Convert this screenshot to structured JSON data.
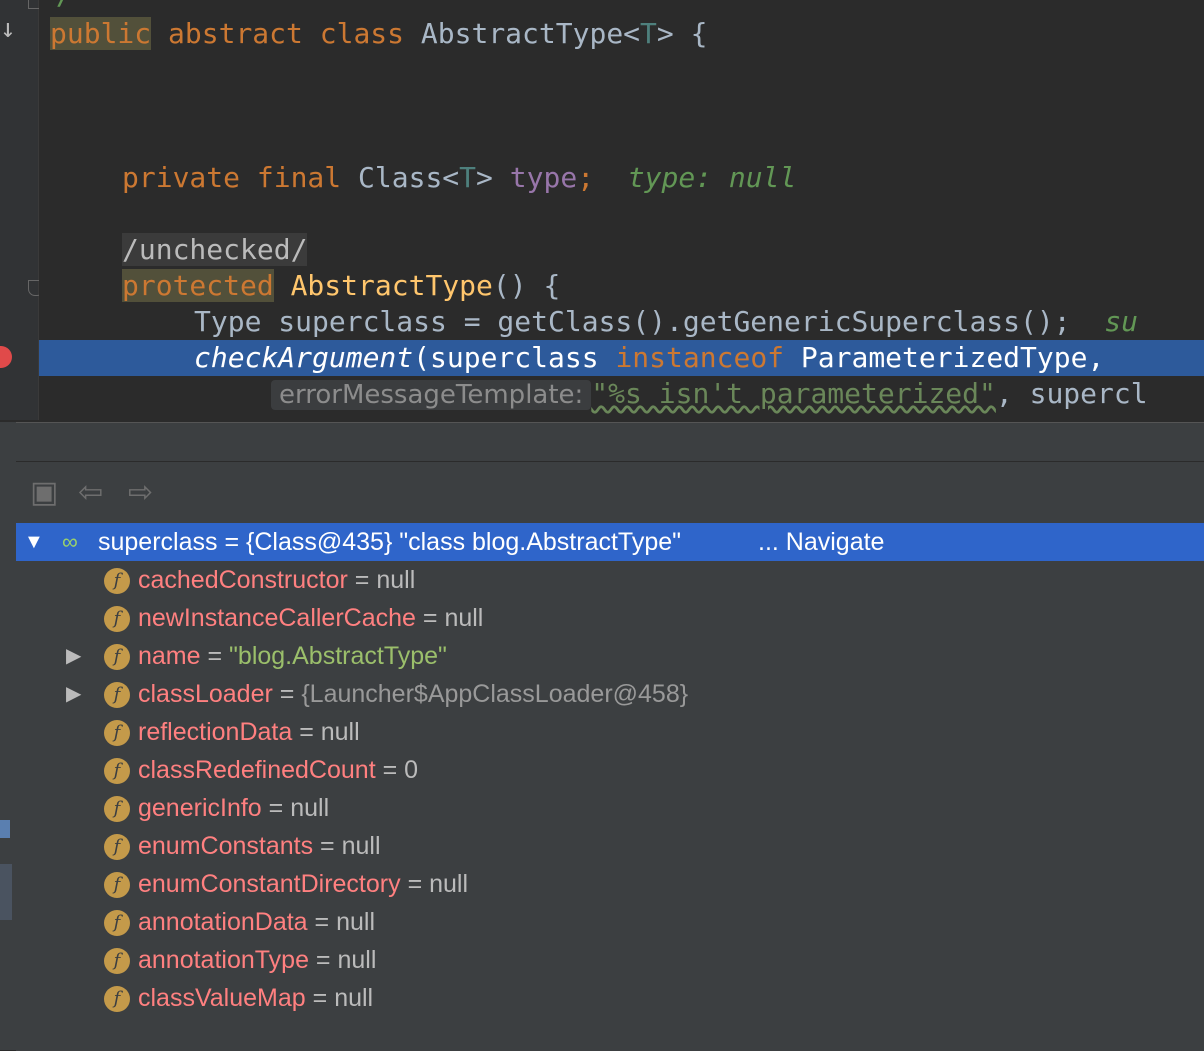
{
  "editor": {
    "line1": {
      "kw1": "public",
      "kw2": "abstract class",
      "name": "AbstractType<",
      "tparam": "T",
      "rest": "> {"
    },
    "line_field": {
      "kw": "private final",
      "type": "Class<",
      "tparam": "T",
      "type_end": ">",
      "name": "type",
      "semi": ";",
      "inline_label": "type:",
      "inline_value": "null"
    },
    "comment": "/unchecked/",
    "line_ctor": {
      "kw": "protected",
      "name": "AbstractType",
      "rest": "() {"
    },
    "line_super": {
      "text": "Type superclass = getClass().getGenericSuperclass();",
      "inline": "su"
    },
    "line_check": {
      "method": "checkArgument",
      "args": "(superclass ",
      "kw": "instanceof",
      "rest": " ParameterizedType,",
      "tail": " "
    },
    "line_hint": {
      "hint": "errorMessageTemplate:",
      "string": "\"%s isn't parameterized\"",
      "rest": ", supercl"
    }
  },
  "debugger": {
    "root": {
      "label": "superclass = {Class@435} \"class blog.AbstractType\"",
      "link": "... Navigate"
    },
    "fields": [
      {
        "name": "cachedConstructor",
        "eq": " = ",
        "value": "null",
        "kind": "val",
        "expandable": false
      },
      {
        "name": "newInstanceCallerCache",
        "eq": " = ",
        "value": "null",
        "kind": "val",
        "expandable": false
      },
      {
        "name": "name",
        "eq": " = ",
        "value": "\"blog.AbstractType\"",
        "kind": "str",
        "expandable": true
      },
      {
        "name": "classLoader",
        "eq": " = ",
        "value": "{Launcher$AppClassLoader@458}",
        "kind": "ref",
        "expandable": true
      },
      {
        "name": "reflectionData",
        "eq": " = ",
        "value": "null",
        "kind": "val",
        "expandable": false
      },
      {
        "name": "classRedefinedCount",
        "eq": " = ",
        "value": "0",
        "kind": "val",
        "expandable": false
      },
      {
        "name": "genericInfo",
        "eq": " = ",
        "value": "null",
        "kind": "val",
        "expandable": false
      },
      {
        "name": "enumConstants",
        "eq": " = ",
        "value": "null",
        "kind": "val",
        "expandable": false
      },
      {
        "name": "enumConstantDirectory",
        "eq": " = ",
        "value": "null",
        "kind": "val",
        "expandable": false
      },
      {
        "name": "annotationData",
        "eq": " = ",
        "value": "null",
        "kind": "val",
        "expandable": false
      },
      {
        "name": "annotationType",
        "eq": " = ",
        "value": "null",
        "kind": "val",
        "expandable": false
      },
      {
        "name": "classValueMap",
        "eq": " = ",
        "value": "null",
        "kind": "val",
        "expandable": false
      }
    ],
    "field_icon_letter": "f"
  },
  "colors": {
    "selection": "#2f65ca",
    "field_name": "#ff8080",
    "keyword": "#cc7832"
  }
}
